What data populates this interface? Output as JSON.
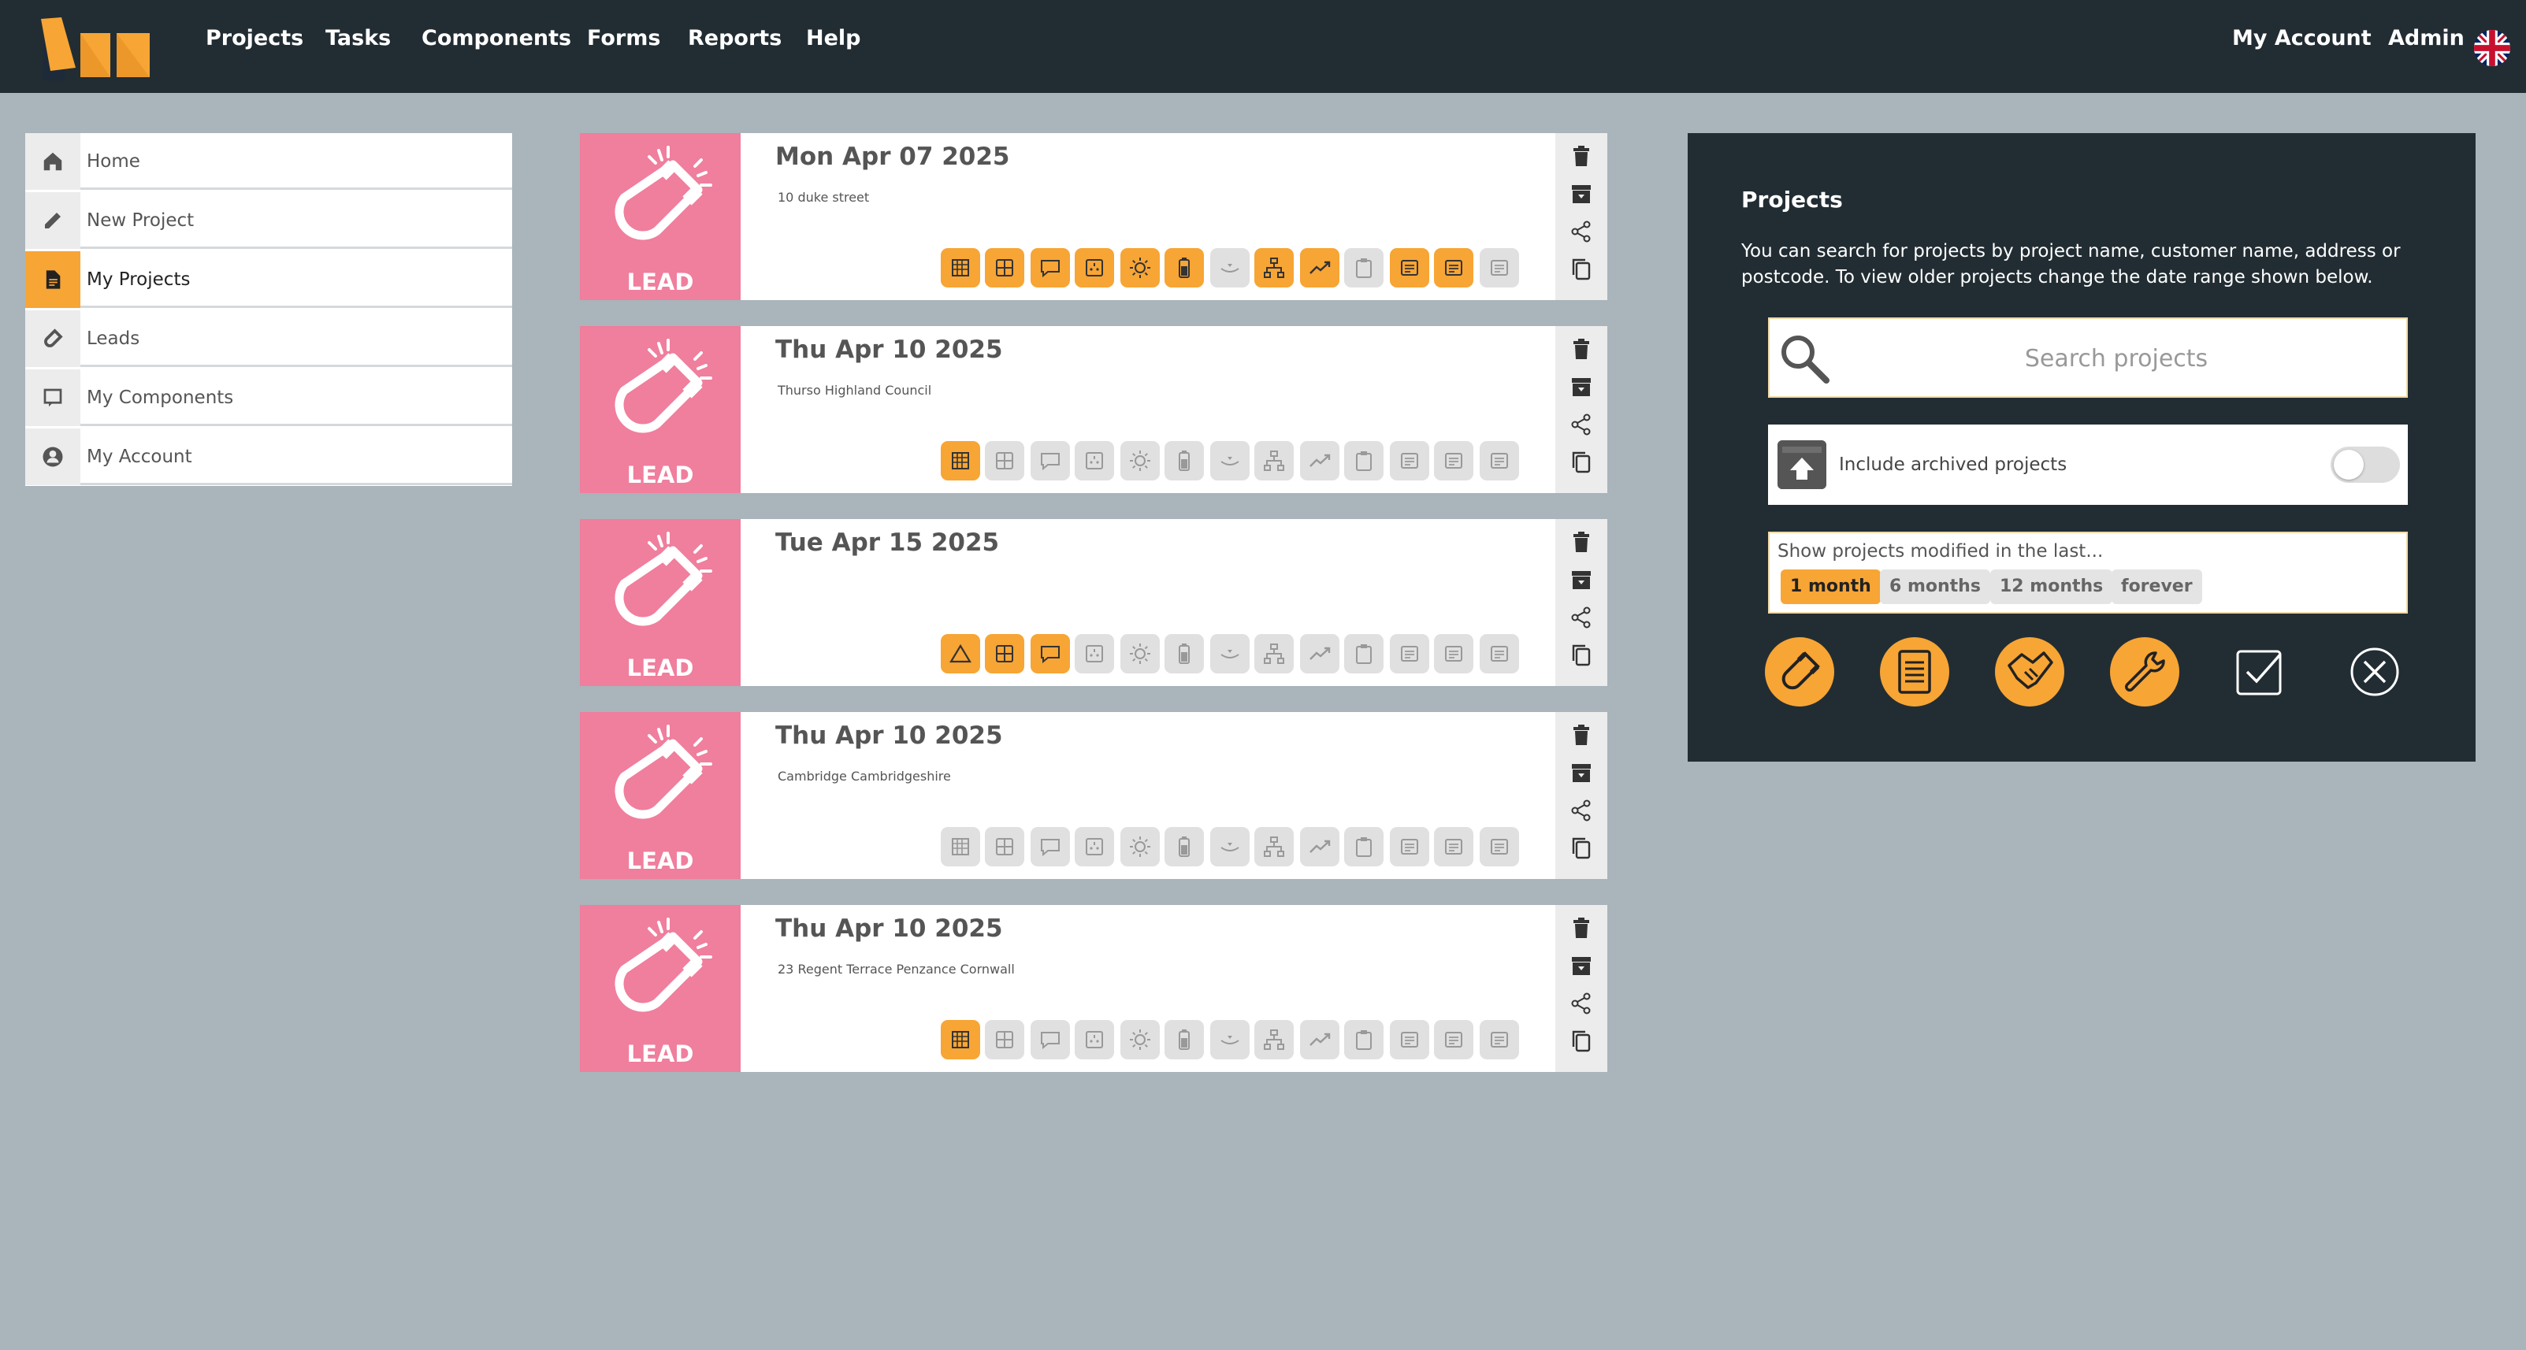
{
  "nav": {
    "items": [
      "Projects",
      "Tasks",
      "Components",
      "Forms",
      "Reports",
      "Help"
    ],
    "account": "My Account",
    "admin": "Admin",
    "language_icon": "uk-flag-icon"
  },
  "sidebar": {
    "items": [
      {
        "label": "Home",
        "icon": "home-icon"
      },
      {
        "label": "New Project",
        "icon": "pencil-icon"
      },
      {
        "label": "My Projects",
        "icon": "document-icon",
        "active": true
      },
      {
        "label": "Leads",
        "icon": "magnet-icon"
      },
      {
        "label": "My Components",
        "icon": "component-icon"
      },
      {
        "label": "My Account",
        "icon": "user-icon"
      }
    ]
  },
  "projects": [
    {
      "date": "Mon Apr 07 2025",
      "address": "10 duke street",
      "badge": "LEAD",
      "status": [
        1,
        1,
        1,
        1,
        1,
        1,
        0,
        1,
        1,
        0,
        1,
        1,
        0
      ]
    },
    {
      "date": "Thu Apr 10 2025",
      "address": "Thurso Highland Council",
      "badge": "LEAD",
      "status": [
        1,
        0,
        0,
        0,
        0,
        0,
        0,
        0,
        0,
        0,
        0,
        0,
        0
      ]
    },
    {
      "date": "Tue Apr 15 2025",
      "address": "",
      "badge": "LEAD",
      "status": [
        1,
        1,
        1,
        0,
        0,
        0,
        0,
        0,
        0,
        0,
        0,
        0,
        0
      ]
    },
    {
      "date": "Thu Apr 10 2025",
      "address": "Cambridge Cambridgeshire",
      "badge": "LEAD",
      "status": [
        0,
        0,
        0,
        0,
        0,
        0,
        0,
        0,
        0,
        0,
        0,
        0,
        0
      ]
    },
    {
      "date": "Thu Apr 10 2025",
      "address": "23 Regent Terrace Penzance Cornwall",
      "badge": "LEAD",
      "status": [
        1,
        0,
        0,
        0,
        0,
        0,
        0,
        0,
        0,
        0,
        0,
        0,
        0
      ]
    }
  ],
  "card_icons": [
    "building-icon",
    "window-icon",
    "speech-icon",
    "panel-icon",
    "sun-icon",
    "battery-icon",
    "meter-icon",
    "network-icon",
    "trend-icon",
    "clipboard-icon",
    "form-icon",
    "form-icon",
    "form-icon"
  ],
  "panel": {
    "title": "Projects",
    "description": "You can search for projects by project name, customer name, address or postcode. To view older projects change the date range shown below.",
    "search_placeholder": "Search projects",
    "archived_label": "Include archived projects",
    "range_label": "Show projects modified in the last...",
    "ranges": [
      "1 month",
      "6 months",
      "12 months",
      "forever"
    ],
    "selected_range": "1 month"
  },
  "colors": {
    "accent": "#f7a535",
    "lead": "#f07e9d",
    "dark": "#222d33",
    "background": "#a9b4bb"
  }
}
